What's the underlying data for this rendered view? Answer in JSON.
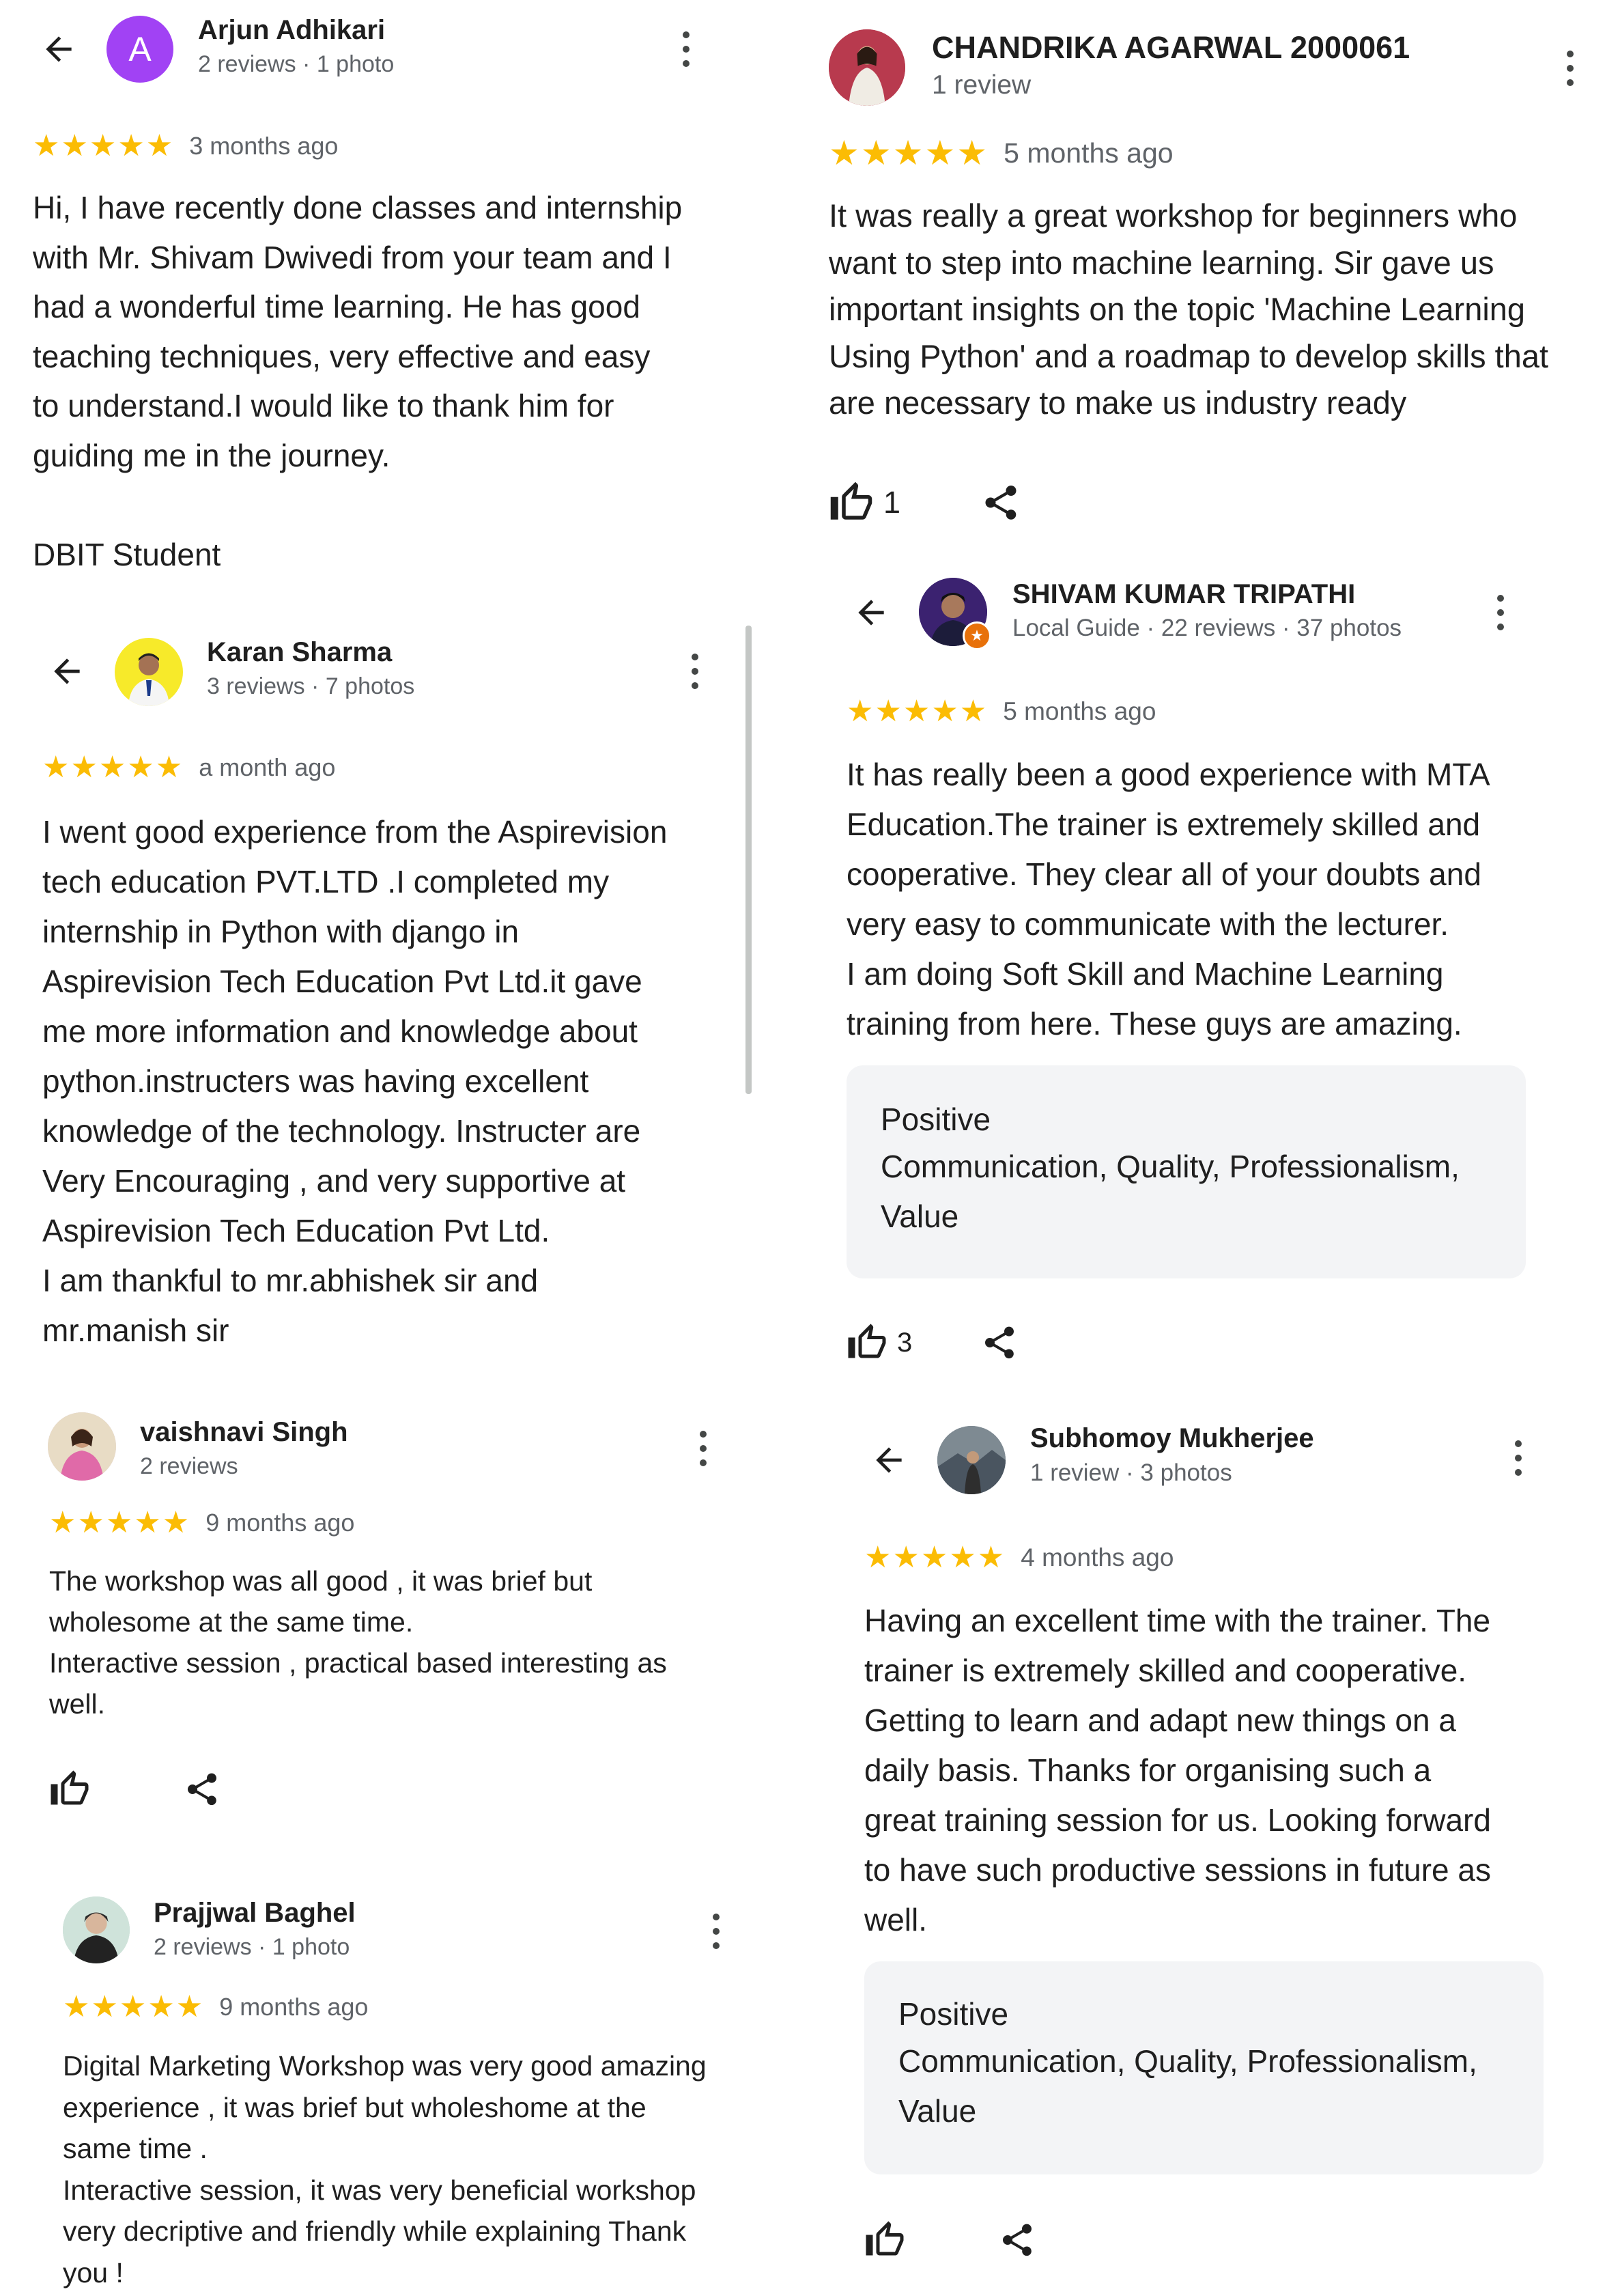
{
  "colors": {
    "star": "#fbbc04",
    "accent_purple": "#a142f4",
    "meta": "#5f6368",
    "chip_bg": "#f3f4f6"
  },
  "left": [
    {
      "name": "Arjun Adhikari",
      "meta": "2 reviews · 1 photo",
      "avatar_letter": "A",
      "stars": "★★★★★",
      "when": "3 months ago",
      "text": "Hi, I have recently done classes and internship\nwith Mr. Shivam Dwivedi from your team and I\nhad a wonderful time learning. He has good\nteaching techniques, very effective and easy\nto understand.I would like to thank him for\nguiding me in the journey.\n\nDBIT Student"
    },
    {
      "name": "Karan Sharma",
      "meta": "3 reviews · 7 photos",
      "stars": "★★★★★",
      "when": "a month ago",
      "text": "I went good experience from the Aspirevision\ntech education PVT.LTD .I completed my\ninternship in Python with django in\nAspirevision Tech Education Pvt Ltd.it gave\nme more information and knowledge about\npython.instructers was having excellent\nknowledge of the technology. Instructer are\nVery Encouraging , and very supportive at\nAspirevision Tech Education Pvt Ltd.\nI am thankful to mr.abhishek sir and\nmr.manish sir"
    },
    {
      "name": "vaishnavi Singh",
      "meta": "2 reviews",
      "stars": "★★★★★",
      "when": "9 months ago",
      "text": "The workshop was all good , it was brief but\nwholesome at the same time.\nInteractive session , practical based interesting as\nwell."
    },
    {
      "name": "Prajjwal Baghel",
      "meta": "2 reviews · 1 photo",
      "stars": "★★★★★",
      "when": "9 months ago",
      "text": "Digital Marketing Workshop was very good amazing\nexperience , it was brief but wholeshome at the\nsame time .\nInteractive session, it was very beneficial workshop\nvery decriptive and friendly while explaining Thank\nyou !"
    }
  ],
  "right": [
    {
      "name": "CHANDRIKA AGARWAL 2000061",
      "meta": "1 review",
      "stars": "★★★★★",
      "when": "5 months ago",
      "text": "It was really a great workshop for beginners who\nwant to step into machine learning. Sir gave us\nimportant insights on the topic 'Machine Learning\nUsing Python' and a roadmap to develop skills that\nare necessary to make us industry ready",
      "likes": "1"
    },
    {
      "name": "SHIVAM KUMAR TRIPATHI",
      "meta": "Local Guide · 22 reviews · 37 photos",
      "stars": "★★★★★",
      "when": "5 months ago",
      "text": "It has really been a good experience with MTA\nEducation.The trainer is extremely skilled and\ncooperative. They clear all of your doubts and\nvery easy to communicate with the lecturer.\nI am doing Soft Skill and Machine Learning\ntraining from here. These guys are amazing.",
      "positive_title": "Positive",
      "positive_body": "Communication, Quality, Professionalism,\nValue",
      "likes": "3"
    },
    {
      "name": "Subhomoy Mukherjee",
      "meta": "1 review · 3 photos",
      "stars": "★★★★★",
      "when": "4 months ago",
      "text": "Having an excellent time with the trainer. The\ntrainer is extremely skilled and cooperative.\nGetting to learn and adapt new things on a\ndaily basis. Thanks for organising such a\ngreat training session for us. Looking forward\nto have such productive sessions in future as\nwell.",
      "positive_title": "Positive",
      "positive_body": "Communication, Quality, Professionalism,\nValue"
    }
  ]
}
